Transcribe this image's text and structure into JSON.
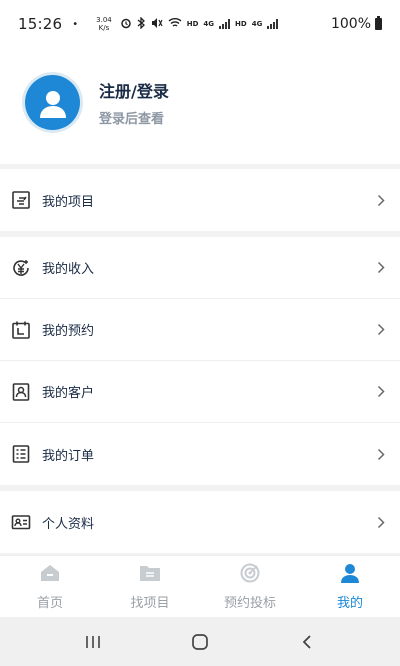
{
  "status_bar": {
    "time": "15:26",
    "dot": "•",
    "net_speed_value": "3.04",
    "net_speed_unit": "K/s",
    "hd1": "HD",
    "hd2": "HD",
    "net1": "4G",
    "net2": "4G",
    "battery_text": "100%"
  },
  "profile": {
    "title": "注册/登录",
    "subtitle": "登录后查看"
  },
  "menu": {
    "groups": [
      {
        "items": [
          {
            "label": "我的项目",
            "icon": "project-icon"
          }
        ]
      },
      {
        "items": [
          {
            "label": "我的收入",
            "icon": "income-icon"
          },
          {
            "label": "我的预约",
            "icon": "calendar-icon"
          },
          {
            "label": "我的客户",
            "icon": "customer-icon"
          },
          {
            "label": "我的订单",
            "icon": "order-icon"
          }
        ]
      },
      {
        "items": [
          {
            "label": "个人资料",
            "icon": "profile-card-icon"
          }
        ]
      }
    ]
  },
  "tabs": [
    {
      "label": "首页",
      "icon": "home-icon",
      "active": false
    },
    {
      "label": "找项目",
      "icon": "folder-icon",
      "active": false
    },
    {
      "label": "预约投标",
      "icon": "target-icon",
      "active": false
    },
    {
      "label": "我的",
      "icon": "user-icon",
      "active": true
    }
  ],
  "colors": {
    "accent": "#1e88d6",
    "inactive_tab": "#9aa0a6",
    "text_dark": "#1a2b45",
    "text_muted": "#8e98a5",
    "background": "#f2f2f2"
  }
}
